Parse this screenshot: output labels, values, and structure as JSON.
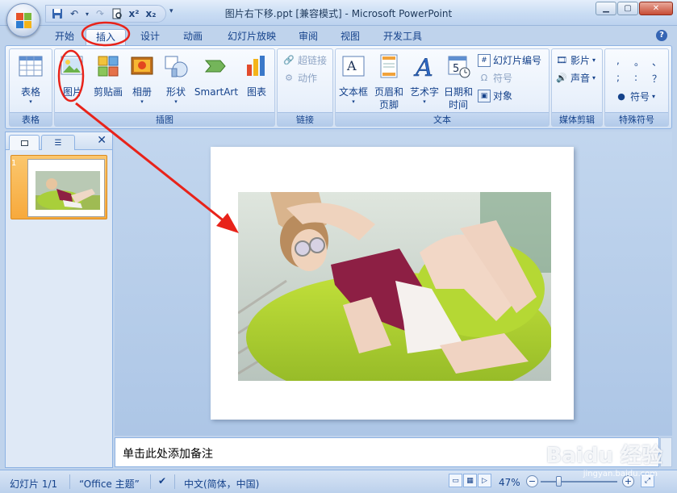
{
  "window": {
    "title": "图片右下移.ppt [兼容模式] - Microsoft PowerPoint"
  },
  "tabs": [
    "开始",
    "插入",
    "设计",
    "动画",
    "幻灯片放映",
    "审阅",
    "视图",
    "开发工具"
  ],
  "active_tab": "插入",
  "ribbon": {
    "groups": {
      "table": {
        "label": "表格",
        "btn_table": "表格"
      },
      "illustrations": {
        "label": "插图",
        "btn_picture": "图片",
        "btn_clipart": "剪贴画",
        "btn_album": "相册",
        "btn_shapes": "形状",
        "btn_smartart": "SmartArt",
        "btn_chart": "图表"
      },
      "links": {
        "label": "链接",
        "btn_hyperlink": "超链接",
        "btn_action": "动作"
      },
      "text": {
        "label": "文本",
        "btn_textbox": "文本框",
        "btn_header_1": "页眉和",
        "btn_header_2": "页脚",
        "btn_wordart": "艺术字",
        "btn_datetime_1": "日期和",
        "btn_datetime_2": "时间",
        "btn_slidenum": "幻灯片编号",
        "btn_symbol": "符号",
        "btn_object": "对象"
      },
      "media": {
        "label": "媒体剪辑",
        "btn_movie": "影片",
        "btn_sound": "声音"
      },
      "special": {
        "label": "特殊符号",
        "chars": [
          ",",
          "。",
          "、",
          ";",
          ":",
          "？"
        ],
        "btn_symbol": "符号"
      }
    }
  },
  "thumbnails": {
    "slide_number": "1"
  },
  "notes": {
    "placeholder": "单击此处添加备注"
  },
  "statusbar": {
    "slide_info": "幻灯片 1/1",
    "theme": "“Office 主题”",
    "language": "中文(简体，中国)",
    "zoom": "47%"
  },
  "watermark": {
    "brand": "Baidu 经验",
    "url": "jingyan.baidu.com"
  },
  "colors": {
    "annotation": "#e8231a",
    "ribbon_text": "#15428b"
  }
}
